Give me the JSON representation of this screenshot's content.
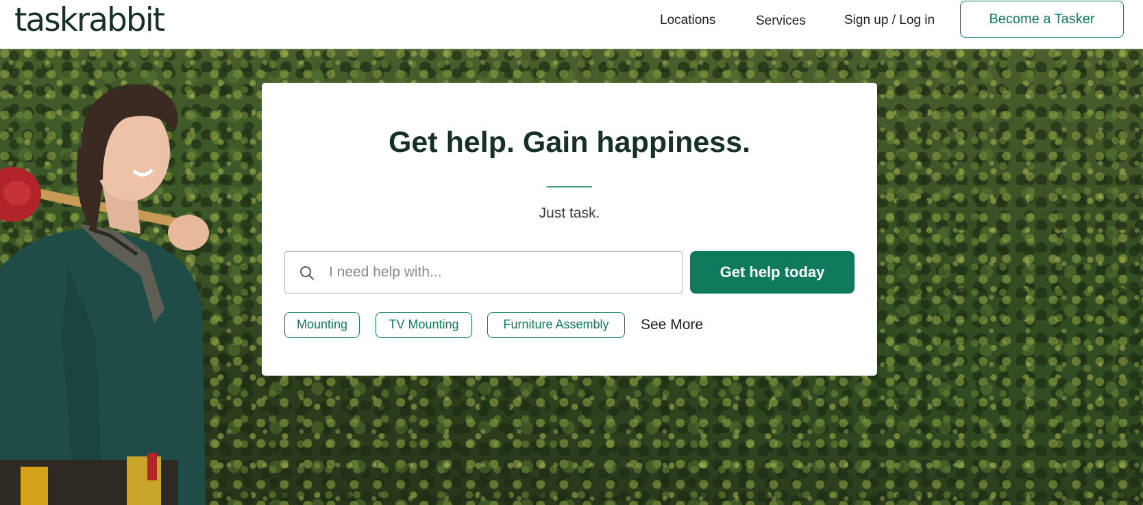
{
  "header": {
    "logo": "taskrabbit",
    "nav": {
      "locations": "Locations",
      "services": "Services",
      "signup": "Sign up / Log in"
    },
    "become_tasker": "Become a Tasker"
  },
  "hero": {
    "title": "Get help. Gain happiness.",
    "subtitle": "Just task.",
    "search": {
      "placeholder": "I need help with...",
      "value": "",
      "icon": "search-icon"
    },
    "cta": "Get help today",
    "chips": [
      "Mounting",
      "TV Mounting",
      "Furniture Assembly"
    ],
    "see_more": "See More"
  },
  "colors": {
    "brand_green": "#0f7b5c",
    "logo_dark": "#173124",
    "divider": "#4a9e87"
  }
}
